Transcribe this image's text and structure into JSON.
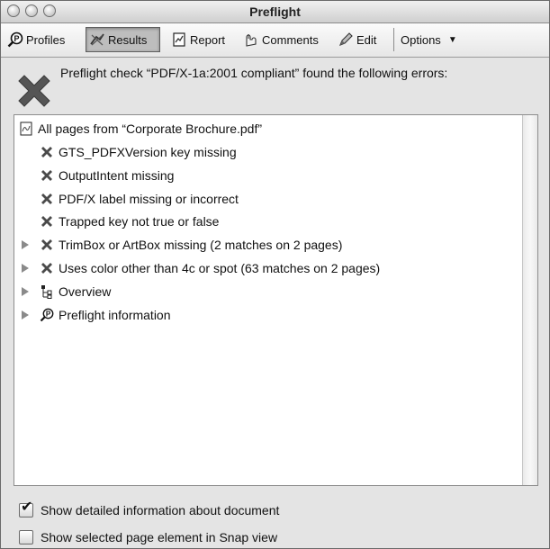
{
  "window": {
    "title": "Preflight"
  },
  "toolbar": {
    "profiles_label": "Profiles",
    "results_label": "Results",
    "report_label": "Report",
    "comments_label": "Comments",
    "edit_label": "Edit",
    "options_label": "Options"
  },
  "header": {
    "message": "Preflight check “PDF/X-1a:2001 compliant” found the following errors:"
  },
  "tree": {
    "root_label": "All pages from “Corporate Brochure.pdf”",
    "errors": [
      {
        "label": "GTS_PDFXVersion key missing",
        "icon": "error-x-icon",
        "expandable": false
      },
      {
        "label": "OutputIntent missing",
        "icon": "error-x-icon",
        "expandable": false
      },
      {
        "label": "PDF/X label missing or incorrect",
        "icon": "error-x-icon",
        "expandable": false
      },
      {
        "label": "Trapped key not true or false",
        "icon": "error-x-icon",
        "expandable": false
      },
      {
        "label": "TrimBox or ArtBox missing (2 matches on 2 pages)",
        "icon": "error-x-icon",
        "expandable": true
      },
      {
        "label": "Uses color other than 4c or spot (63 matches on 2 pages)",
        "icon": "error-x-icon",
        "expandable": true
      }
    ],
    "overview_label": "Overview",
    "preflight_info_label": "Preflight information"
  },
  "options": {
    "show_detailed_label": "Show detailed information about document",
    "show_detailed_checked": true,
    "show_snap_label": "Show selected page element in Snap view",
    "show_snap_checked": false
  }
}
